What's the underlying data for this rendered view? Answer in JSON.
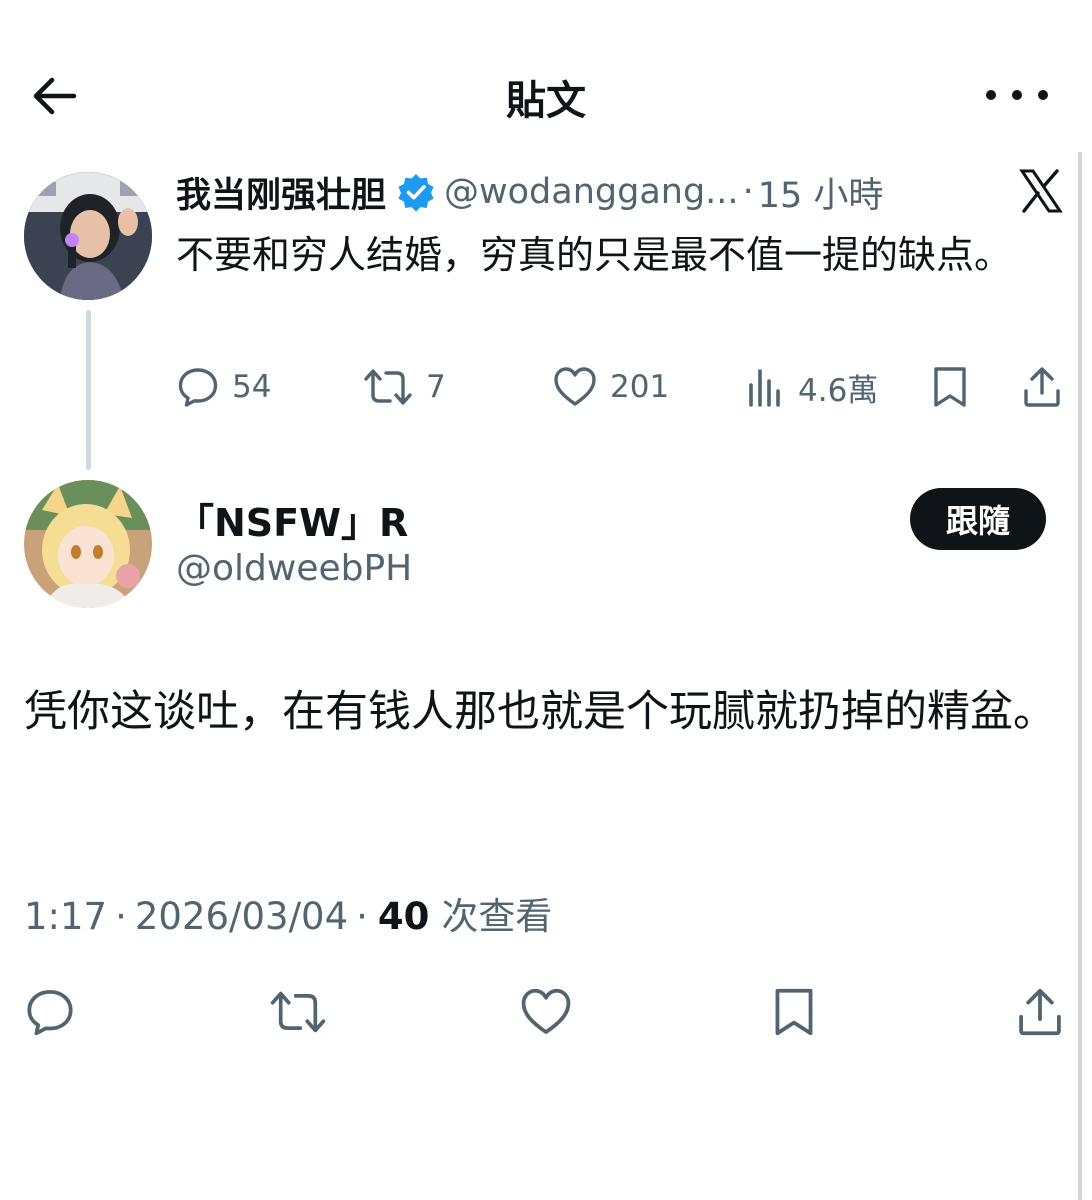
{
  "header": {
    "title": "貼文"
  },
  "parent_tweet": {
    "author_name": "我当刚强壮胆",
    "handle": "@wodanggang...",
    "separator": "·",
    "time": "15 小時",
    "text": "不要和穷人结婚，穷真的只是最不值一提的缺点。",
    "counts": {
      "replies": "54",
      "reposts": "7",
      "likes": "201",
      "views": "4.6萬"
    }
  },
  "main_tweet": {
    "author_name": "「NSFW」R",
    "handle": "@oldweebPH",
    "follow_label": "跟隨",
    "text": "凭你这谈吐，在有钱人那也就是个玩腻就扔掉的精盆。",
    "meta": {
      "time": "1:17",
      "date": "2026/03/04",
      "separator": "·",
      "views_count": "40",
      "views_label": "次查看"
    }
  },
  "colors": {
    "text_primary": "#0f1419",
    "text_secondary": "#536471",
    "verified_blue": "#1d9bf0",
    "thread_line": "#cfd9de"
  }
}
